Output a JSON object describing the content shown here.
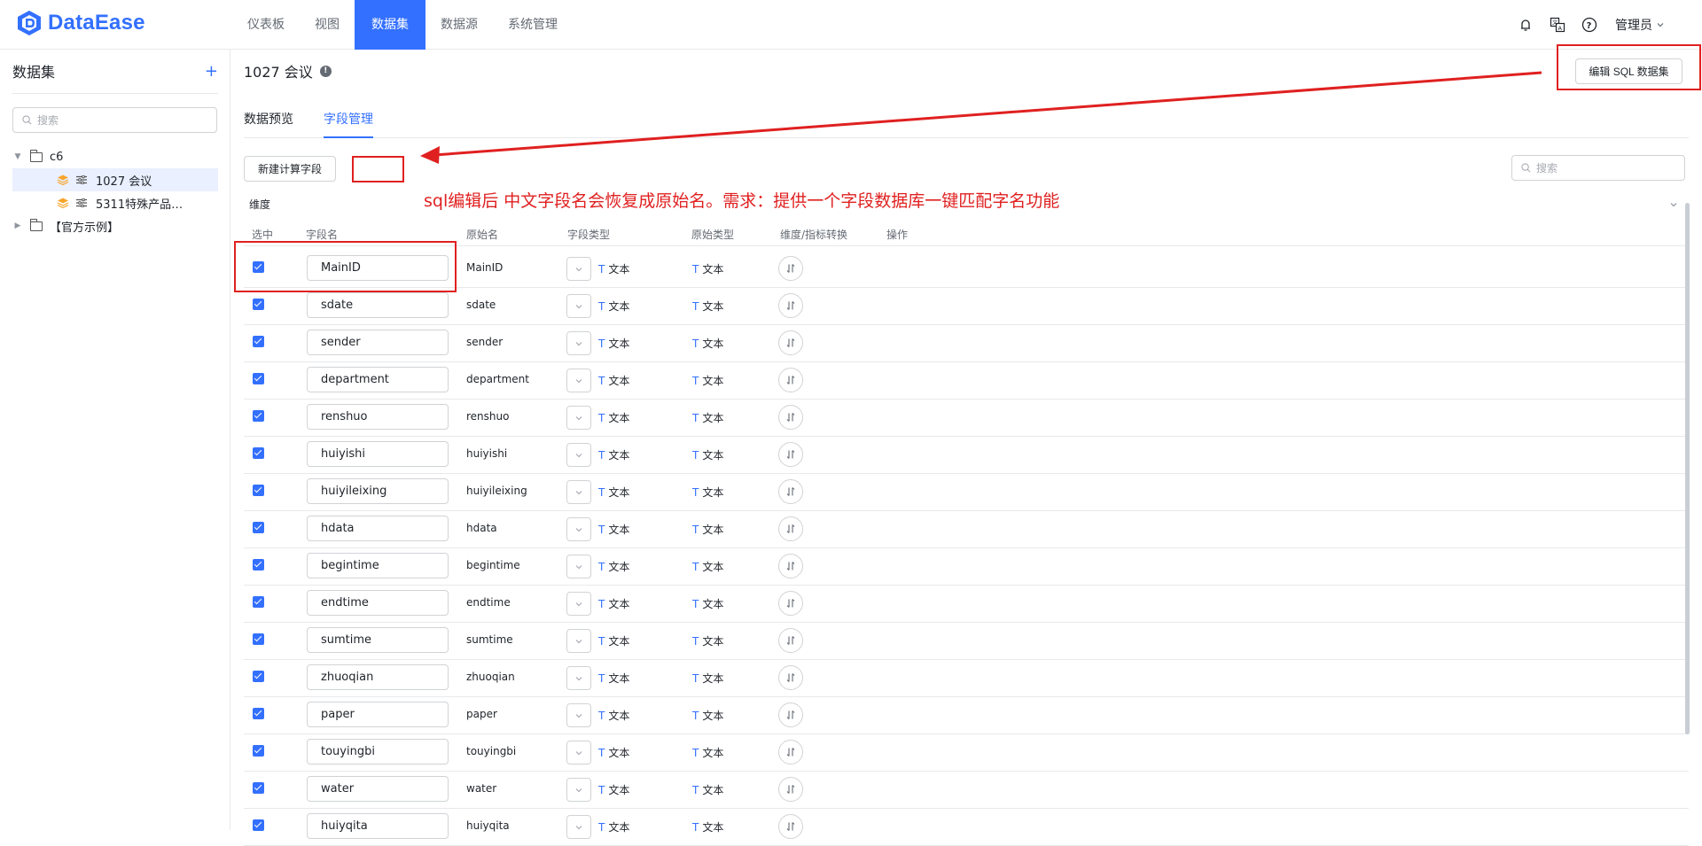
{
  "app": {
    "name": "DataEase",
    "nav": [
      "仪表板",
      "视图",
      "数据集",
      "数据源",
      "系统管理"
    ],
    "active_nav": "数据集",
    "user": "管理员"
  },
  "sidebar": {
    "title": "数据集",
    "search_placeholder": "搜索",
    "tree": [
      {
        "label": "c6",
        "type": "folder",
        "expanded": true
      },
      {
        "label": "1027 会议",
        "type": "dataset",
        "selected": true
      },
      {
        "label": "5311特殊产品…",
        "type": "dataset"
      },
      {
        "label": "【官方示例】",
        "type": "folder",
        "expanded": false
      }
    ]
  },
  "main": {
    "title": "1027 会议",
    "edit_sql_button": "编辑 SQL 数据集",
    "tabs": [
      "数据预览",
      "字段管理"
    ],
    "active_tab": "字段管理",
    "new_calc_button": "新建计算字段",
    "search_placeholder": "搜索",
    "section_label": "维度",
    "columns": [
      "选中",
      "字段名",
      "原始名",
      "字段类型",
      "原始类型",
      "维度/指标转换",
      "操作"
    ],
    "type_glyph": "T",
    "type_text": "文本",
    "fields": [
      {
        "name": "MainID",
        "origin": "MainID"
      },
      {
        "name": "sdate",
        "origin": "sdate"
      },
      {
        "name": "sender",
        "origin": "sender"
      },
      {
        "name": "department",
        "origin": "department"
      },
      {
        "name": "renshuo",
        "origin": "renshuo"
      },
      {
        "name": "huiyishi",
        "origin": "huiyishi"
      },
      {
        "name": "huiyileixing",
        "origin": "huiyileixing"
      },
      {
        "name": "hdata",
        "origin": "hdata"
      },
      {
        "name": "begintime",
        "origin": "begintime"
      },
      {
        "name": "endtime",
        "origin": "endtime"
      },
      {
        "name": "sumtime",
        "origin": "sumtime"
      },
      {
        "name": "zhuoqian",
        "origin": "zhuoqian"
      },
      {
        "name": "paper",
        "origin": "paper"
      },
      {
        "name": "touyingbi",
        "origin": "touyingbi"
      },
      {
        "name": "water",
        "origin": "water"
      },
      {
        "name": "huiyqita",
        "origin": "huiyqita"
      }
    ]
  },
  "annotation": {
    "text": "sql编辑后 中文字段名会恢复成原始名。需求：提供一个字段数据库一键匹配字名功能",
    "color": "#e02020"
  },
  "colors": {
    "accent": "#3370ff",
    "annotation": "#e02020"
  }
}
